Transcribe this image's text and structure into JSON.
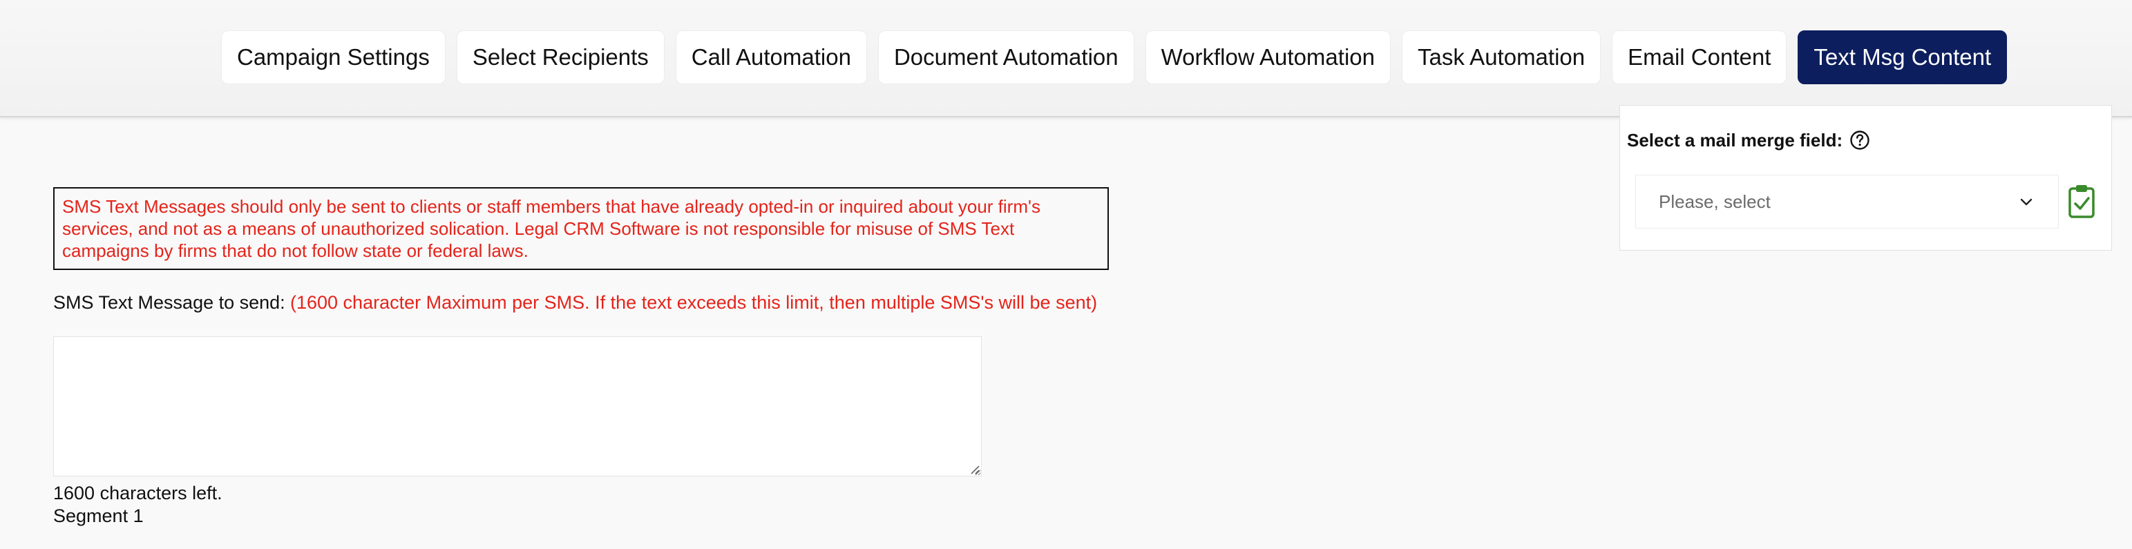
{
  "tabs": [
    {
      "label": "Campaign Settings"
    },
    {
      "label": "Select Recipients"
    },
    {
      "label": "Call Automation"
    },
    {
      "label": "Document Automation"
    },
    {
      "label": "Workflow Automation"
    },
    {
      "label": "Task Automation"
    },
    {
      "label": "Email Content"
    },
    {
      "label": "Text Msg Content",
      "active": true
    }
  ],
  "notice": {
    "text": "SMS Text Messages should only be sent to clients or staff members that have already opted-in or inquired about your firm's services, and not as a means of unauthorized solication. Legal CRM Software is not responsible for misuse of SMS Text campaigns by firms that do not follow state or federal laws."
  },
  "message": {
    "label": "SMS Text Message to send:",
    "hint": "(1600 character Maximum per SMS. If the text exceeds this limit, then multiple SMS's will be sent)",
    "value": "",
    "chars_left": "1600 characters left.",
    "segment": "Segment 1"
  },
  "merge": {
    "title": "Select a mail merge field:",
    "select_placeholder": "Please, select",
    "help_icon": "question-circle-icon",
    "copy_icon": "clipboard-check-icon"
  },
  "colors": {
    "active_tab": "#0d1e5e",
    "warning_text": "#e4241b",
    "clipboard_icon": "#3a8a2c"
  }
}
